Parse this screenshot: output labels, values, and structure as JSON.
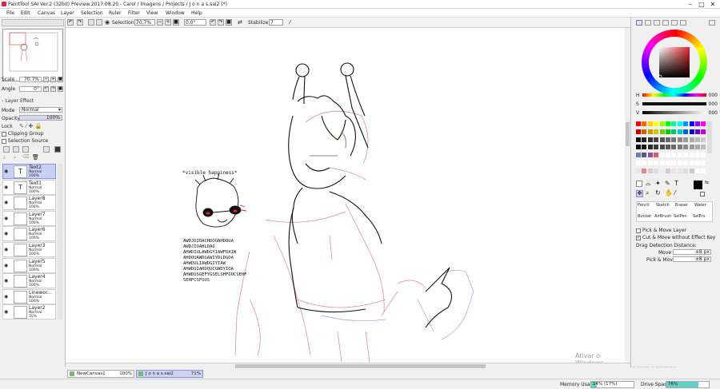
{
  "titlebar": {
    "title": "PaintTool SAI Ver.2 (32bit) Preview.2017.08.20 - Carol / Imagens / Projects / J o n a s.sai2 (*)",
    "minimize": "–",
    "maximize": "□",
    "close": "✕"
  },
  "menu": [
    "File",
    "Edit",
    "Canvas",
    "Layer",
    "Selection",
    "Ruler",
    "Filter",
    "View",
    "Window",
    "Help"
  ],
  "toolbar": {
    "selection_label": "Selection",
    "zoom_value": "70.7%",
    "rotation_value": "0.0°",
    "stabilizer_label": "Stabilizer",
    "stabilizer_value": "7"
  },
  "left_panel": {
    "scale_label": "Scale",
    "scale_value": "70.7%",
    "angle_label": "Angle",
    "angle_value": "0°",
    "layer_effect": "Layer Effect",
    "mode_label": "Mode",
    "mode_value": "Normal",
    "opacity_label": "Opacity",
    "opacity_value": "100%",
    "lock_label": "Lock",
    "clipping_group": "Clipping Group",
    "selection_source": "Selection Source",
    "layers": [
      {
        "name": "Text2",
        "mode": "Normal",
        "opacity": "100%",
        "thumb": "T",
        "selected": true
      },
      {
        "name": "Text1",
        "mode": "Normal",
        "opacity": "100%",
        "thumb": "T",
        "selected": false
      },
      {
        "name": "Layer8",
        "mode": "Normal",
        "opacity": "100%",
        "thumb": "",
        "selected": false
      },
      {
        "name": "Layer7",
        "mode": "Normal",
        "opacity": "100%",
        "thumb": "",
        "selected": false
      },
      {
        "name": "Layer6",
        "mode": "Normal",
        "opacity": "100%",
        "thumb": "",
        "selected": false
      },
      {
        "name": "Layer3",
        "mode": "Normal",
        "opacity": "100%",
        "thumb": "",
        "selected": false
      },
      {
        "name": "Layer5",
        "mode": "Normal",
        "opacity": "100%",
        "thumb": "",
        "selected": false
      },
      {
        "name": "Layer4",
        "mode": "Normal",
        "opacity": "100%",
        "thumb": "",
        "selected": false
      },
      {
        "name": "Linewor...",
        "mode": "Normal",
        "opacity": "100%",
        "thumb": "",
        "selected": false
      },
      {
        "name": "Layer2",
        "mode": "Normal",
        "opacity": "35%",
        "thumb": "",
        "selected": false
      }
    ]
  },
  "canvas_text": {
    "caption": "*visible happiness*",
    "lines": [
      "AWDJDIOACHDOUAHDOUA",
      "AWDJIOAHLDAO",
      "AHWDIULAWDGYIAWFDAIW",
      "AHDOUAWDGAWIYDLDGOA",
      "AHWDULIAWDGIYIAW",
      "AHWDUIAHDOUCGWDYIOA",
      "AHWDUSGEFYGSELSHFOUCSEHF",
      "SEHFCSFOUS"
    ]
  },
  "right_panel": {
    "h_label": "H",
    "h_value": "000",
    "s_label": "S",
    "s_value": "000",
    "v_label": "V",
    "v_value": "000",
    "tools": [
      "Pencil",
      "Sketch",
      "Eraser",
      "Water",
      "Bucket",
      "AirBrush",
      "SelPen",
      "SelErs"
    ],
    "pick_move_layer": "Pick & Move Layer",
    "cut_move": "Cut & Move without Effect Key",
    "drag_distance": "Drag Detection Distance:",
    "move_label": "Move",
    "move_value": "±8 px",
    "pickmove_label": "Pick & Move",
    "pickmove_value": "±8 px"
  },
  "tabs": [
    {
      "name": "NewCanvas1",
      "zoom": "100%"
    },
    {
      "name": "J o n a s.sai2",
      "zoom": "71%"
    }
  ],
  "status": {
    "memory_label": "Memory Usage",
    "memory_value": "14% (17%)",
    "memory_fill": 0.14,
    "drive_label": "Drive Space",
    "drive_value": "76%",
    "drive_fill": 0.76
  },
  "watermark": {
    "line1": "Ativar o Windows",
    "line2": "Acesse Configurações para ativar o Windows."
  },
  "colors": {
    "selected_layer": "#c8cff5",
    "accent_teal": "#5fd0c6",
    "current_color": "#000000"
  }
}
